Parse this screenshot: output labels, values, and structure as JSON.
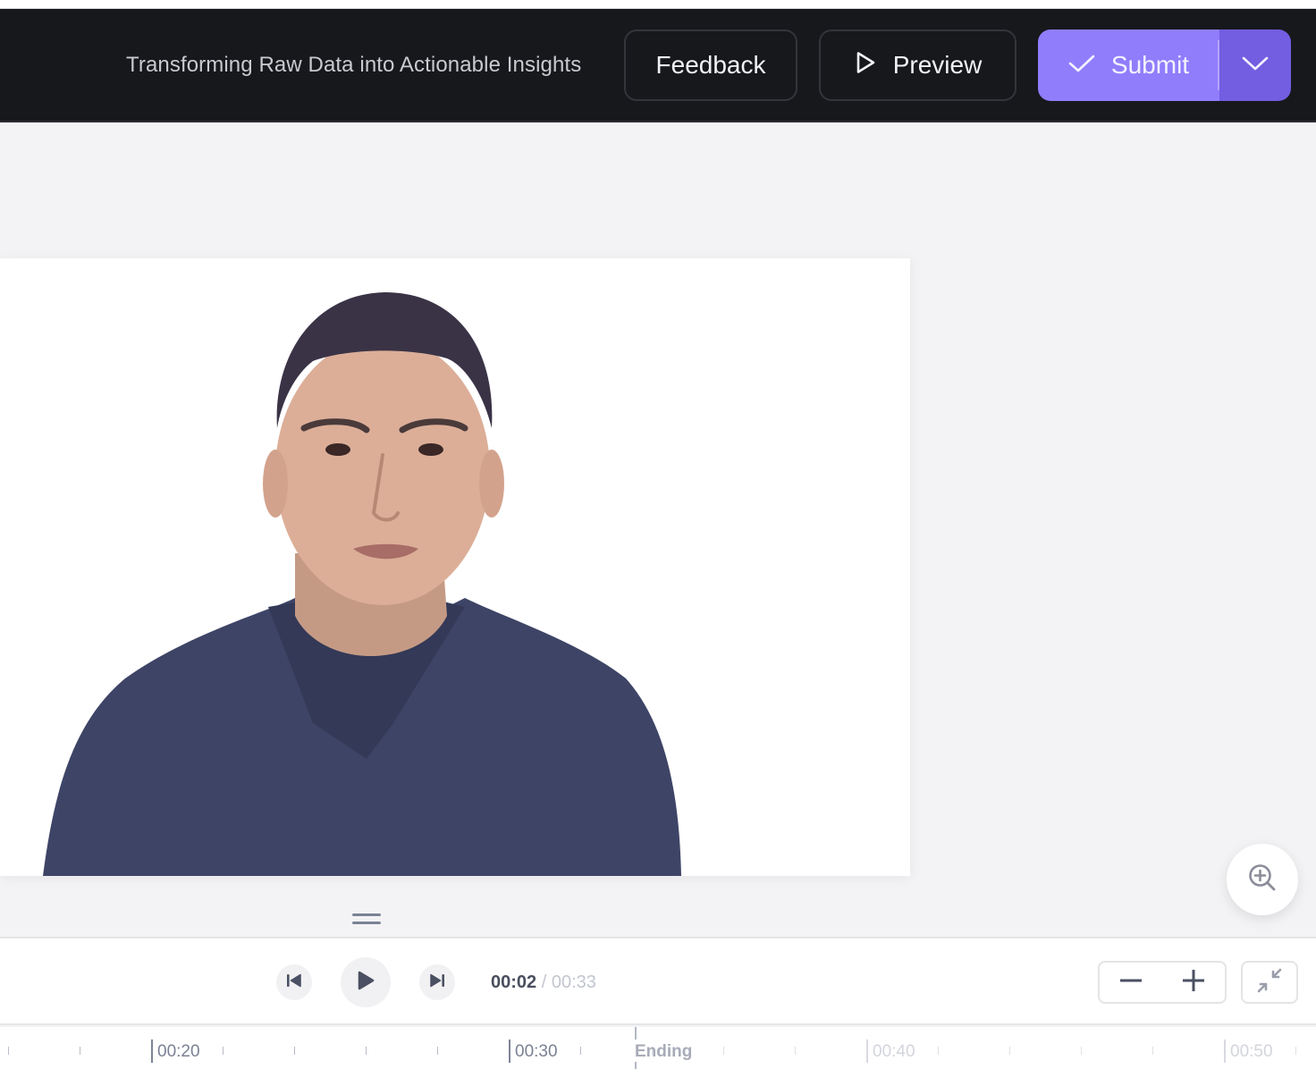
{
  "header": {
    "title": "Transforming Raw Data into Actionable Insights",
    "feedback_label": "Feedback",
    "preview_label": "Preview",
    "submit_label": "Submit",
    "accent_color": "#907dfc",
    "accent_dark_color": "#735de0"
  },
  "canvas": {
    "video_subject": "presenter-avatar",
    "drag_handle": "resize-handle",
    "zoom_fab_icon": "zoom-in-icon"
  },
  "player": {
    "current_time": "00:02",
    "separator": "/",
    "duration": "00:33",
    "zoom_out_icon": "minus-icon",
    "zoom_in_icon": "plus-icon",
    "fit_icon": "collapse-arrows-icon"
  },
  "timeline": {
    "labels": [
      {
        "text": "00:20",
        "dim": false
      },
      {
        "text": "00:30",
        "dim": false
      },
      {
        "text": "00:40",
        "dim": true
      },
      {
        "text": "00:50",
        "dim": true
      }
    ],
    "ending_label": "Ending"
  }
}
